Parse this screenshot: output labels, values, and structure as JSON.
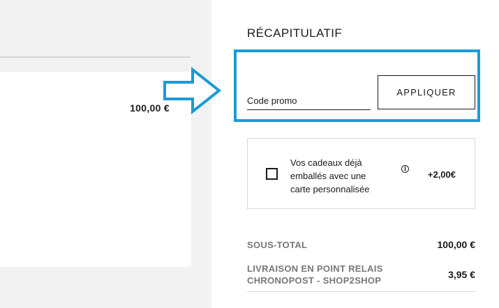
{
  "cart": {
    "item_price": "100,00 €"
  },
  "summary": {
    "title": "RÉCAPITULATIF",
    "promo": {
      "placeholder": "Code promo",
      "apply_label": "APPLIQUER"
    },
    "gift": {
      "text": "Vos cadeaux déjà emballés avec une carte personnalisée",
      "info_symbol": "i",
      "price": "+2,00€"
    },
    "subtotal": {
      "label": "SOUS-TOTAL",
      "value": "100,00 €"
    },
    "shipping": {
      "label": "LIVRAISON EN POINT RELAIS CHRONOPOST - SHOP2SHOP",
      "value": "3,95 €"
    }
  },
  "colors": {
    "highlight": "#1a9bd7",
    "left_background": "#f2f2f2",
    "label_grey": "#777777"
  },
  "icons": {
    "annotation_arrow": "arrow-right-icon",
    "info": "info-icon"
  }
}
